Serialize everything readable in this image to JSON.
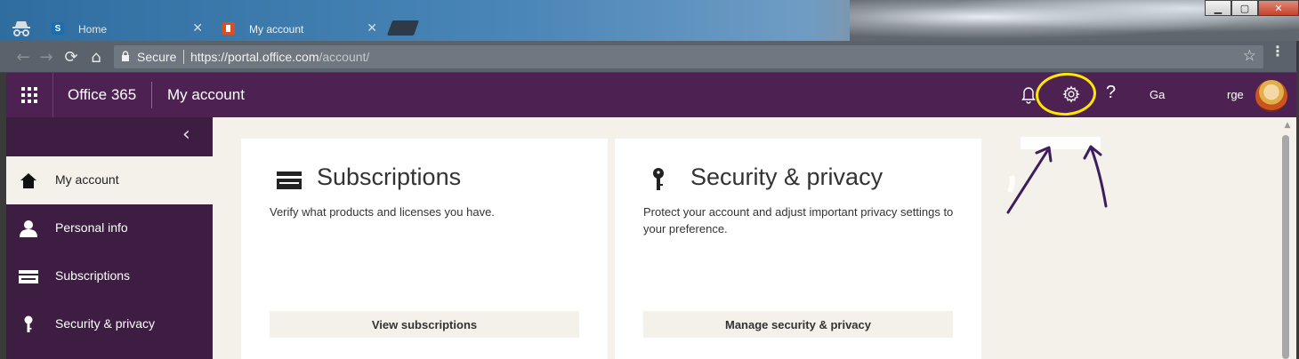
{
  "window": {
    "minimize": "▁",
    "maximize": "▢",
    "close": "✕"
  },
  "tabs": [
    {
      "title": "Home",
      "favicon": "sharepoint-icon",
      "favicon_text": "S",
      "close": "✕"
    },
    {
      "title": "My account",
      "favicon": "office-icon",
      "close": "✕"
    }
  ],
  "toolbar": {
    "back": "←",
    "forward": "→",
    "reload": "⟳",
    "home": "⌂",
    "secure_label": "Secure",
    "url_base": "https://portal.office.com",
    "url_path": "/account/",
    "star": "☆",
    "menu": "⋮"
  },
  "suitebar": {
    "brand": "Office 365",
    "app_name": "My account",
    "help": "?",
    "user_first": "Ga",
    "user_last": "rge",
    "background": "#4d2253"
  },
  "sidebar": {
    "collapse": "‹",
    "items": [
      {
        "label": "My account",
        "icon": "home-icon",
        "selected": true
      },
      {
        "label": "Personal info",
        "icon": "person-icon"
      },
      {
        "label": "Subscriptions",
        "icon": "card-icon"
      },
      {
        "label": "Security & privacy",
        "icon": "key-icon"
      }
    ],
    "background": "#3d1d42"
  },
  "cards": [
    {
      "title": "Subscriptions",
      "icon": "card-icon",
      "description": "Verify what products and licenses you have.",
      "button": "View subscriptions"
    },
    {
      "title": "Security & privacy",
      "icon": "key-icon",
      "description": "Protect your account and adjust important privacy settings to your preference.",
      "button": "Manage security & privacy"
    }
  ],
  "annotation": {
    "circle_color": "#ffe800",
    "arrow_color": "#3d1d5e"
  }
}
